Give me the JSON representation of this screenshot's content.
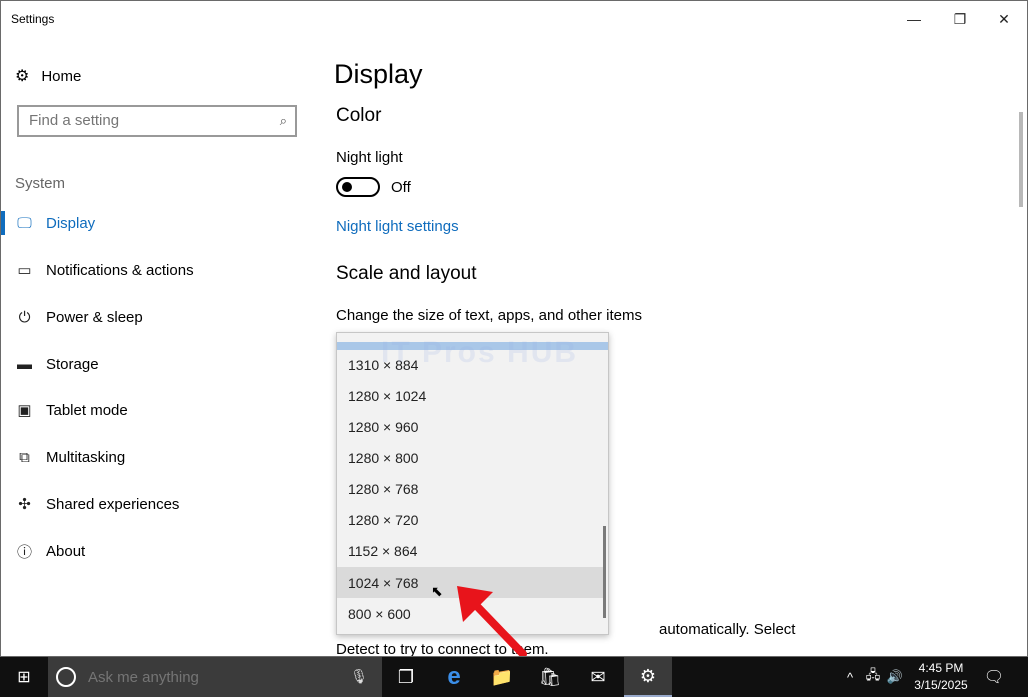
{
  "window": {
    "title": "Settings",
    "minimize_glyph": "—",
    "restore_glyph": "❐",
    "close_glyph": "✕"
  },
  "sidebar": {
    "home": {
      "label": "Home",
      "icon": "gear-icon",
      "glyph": "⚙"
    },
    "search": {
      "placeholder": "Find a setting",
      "glyph": "⌕"
    },
    "section": "System",
    "items": [
      {
        "label": "Display",
        "icon": "monitor-icon",
        "glyph": "🖵",
        "active": true
      },
      {
        "label": "Notifications & actions",
        "icon": "notification-icon",
        "glyph": "▭"
      },
      {
        "label": "Power & sleep",
        "icon": "power-icon",
        "glyph": "⏻"
      },
      {
        "label": "Storage",
        "icon": "storage-icon",
        "glyph": "▬"
      },
      {
        "label": "Tablet mode",
        "icon": "tablet-icon",
        "glyph": "▣"
      },
      {
        "label": "Multitasking",
        "icon": "multitasking-icon",
        "glyph": "⧉"
      },
      {
        "label": "Shared experiences",
        "icon": "share-icon",
        "glyph": "✣"
      },
      {
        "label": "About",
        "icon": "info-icon",
        "glyph": "ⓘ"
      }
    ]
  },
  "main": {
    "title": "Display",
    "color_heading": "Color",
    "night_light_label": "Night light",
    "night_light_state": "Off",
    "night_light_link": "Night light settings",
    "scale_heading": "Scale and layout",
    "scale_label": "Change the size of text, apps, and other items",
    "partial_text_1": "automatically. Select",
    "partial_text_2": "Detect to try to connect to them."
  },
  "resolution_dropdown": {
    "options": [
      "1310 × 884",
      "1280 × 1024",
      "1280 × 960",
      "1280 × 800",
      "1280 × 768",
      "1280 × 720",
      "1152 × 864",
      "1024 × 768",
      "800 × 600"
    ],
    "hovered": "1024 × 768"
  },
  "watermark": "IT Pros HUB",
  "taskbar": {
    "start_glyph": "⊞",
    "search_placeholder": "Ask me anything",
    "mic_glyph": "🎙",
    "apps": [
      {
        "name": "task-view-icon",
        "glyph": "❐"
      },
      {
        "name": "edge-icon",
        "glyph": "e"
      },
      {
        "name": "file-explorer-icon",
        "glyph": "📁"
      },
      {
        "name": "store-icon",
        "glyph": "🛍"
      },
      {
        "name": "mail-icon",
        "glyph": "✉"
      },
      {
        "name": "settings-icon",
        "glyph": "⚙"
      }
    ],
    "tray": {
      "chevron_glyph": "^",
      "network_glyph": "🖧",
      "volume_glyph": "🔊",
      "notification_glyph": "🗨"
    },
    "time": "4:45 PM",
    "date": "3/15/2025"
  },
  "colors": {
    "accent": "#0f6cbd",
    "taskbar": "#101010",
    "arrow": "#e8141b"
  }
}
